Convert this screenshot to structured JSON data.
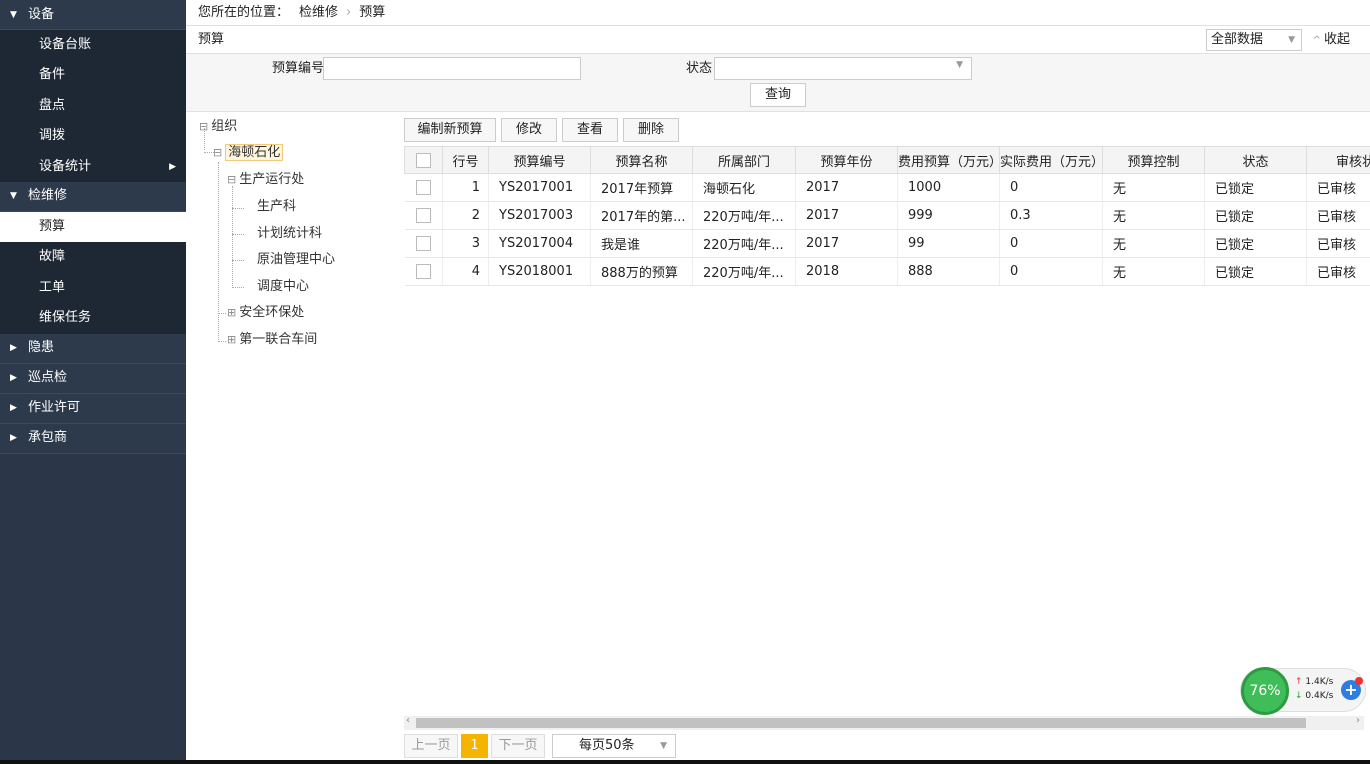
{
  "sidebar": {
    "groups": [
      {
        "label": "设备",
        "expanded": true,
        "items": [
          {
            "label": "设备台账"
          },
          {
            "label": "备件"
          },
          {
            "label": "盘点"
          },
          {
            "label": "调拨"
          },
          {
            "label": "设备统计",
            "has_children": true
          }
        ]
      },
      {
        "label": "检维修",
        "expanded": true,
        "items": [
          {
            "label": "预算",
            "active": true
          },
          {
            "label": "故障"
          },
          {
            "label": "工单"
          },
          {
            "label": "维保任务"
          }
        ]
      },
      {
        "label": "隐患",
        "expanded": false
      },
      {
        "label": "巡点检",
        "expanded": false
      },
      {
        "label": "作业许可",
        "expanded": false
      },
      {
        "label": "承包商",
        "expanded": false
      }
    ]
  },
  "breadcrumb": {
    "prefix": "您所在的位置：",
    "items": [
      "检维修",
      "预算"
    ]
  },
  "panel": {
    "title": "预算",
    "data_select": "全部数据",
    "collapse_label": "收起"
  },
  "filter": {
    "budget_no_label": "预算编号",
    "budget_no_value": "",
    "status_label": "状态",
    "status_value": "",
    "query_label": "查询"
  },
  "tree": {
    "root": "组织",
    "company": "海顿石化",
    "dept1": "生产运行处",
    "dept1_children": [
      "生产科",
      "计划统计科",
      "原油管理中心",
      "调度中心"
    ],
    "dept2": "安全环保处",
    "dept3": "第一联合车间"
  },
  "toolbar": {
    "new": "编制新预算",
    "edit": "修改",
    "view": "查看",
    "delete": "删除"
  },
  "table": {
    "headers": [
      "行号",
      "预算编号",
      "预算名称",
      "所属部门",
      "预算年份",
      "费用预算（万元）",
      "实际费用（万元）",
      "预算控制",
      "状态",
      "审核状"
    ],
    "rows": [
      [
        "1",
        "YS2017001",
        "2017年预算",
        "海顿石化",
        "2017",
        "1000",
        "0",
        "无",
        "已锁定",
        "已审核"
      ],
      [
        "2",
        "YS2017003",
        "2017年的第...",
        "220万吨/年...",
        "2017",
        "999",
        "0.3",
        "无",
        "已锁定",
        "已审核"
      ],
      [
        "3",
        "YS2017004",
        "我是谁",
        "220万吨/年...",
        "2017",
        "99",
        "0",
        "无",
        "已锁定",
        "已审核"
      ],
      [
        "4",
        "YS2018001",
        "888万的预算",
        "220万吨/年...",
        "2018",
        "888",
        "0",
        "无",
        "已锁定",
        "已审核"
      ]
    ]
  },
  "pagination": {
    "prev": "上一页",
    "current": "1",
    "next": "下一页",
    "page_size": "每页50条"
  },
  "net_widget": {
    "percent": "76%",
    "up": "1.4K/s",
    "down": "0.4K/s"
  },
  "colors": {
    "sidebar_bg": "#2b3748",
    "accent": "#f5b400",
    "widget_green": "#3fbd58"
  }
}
